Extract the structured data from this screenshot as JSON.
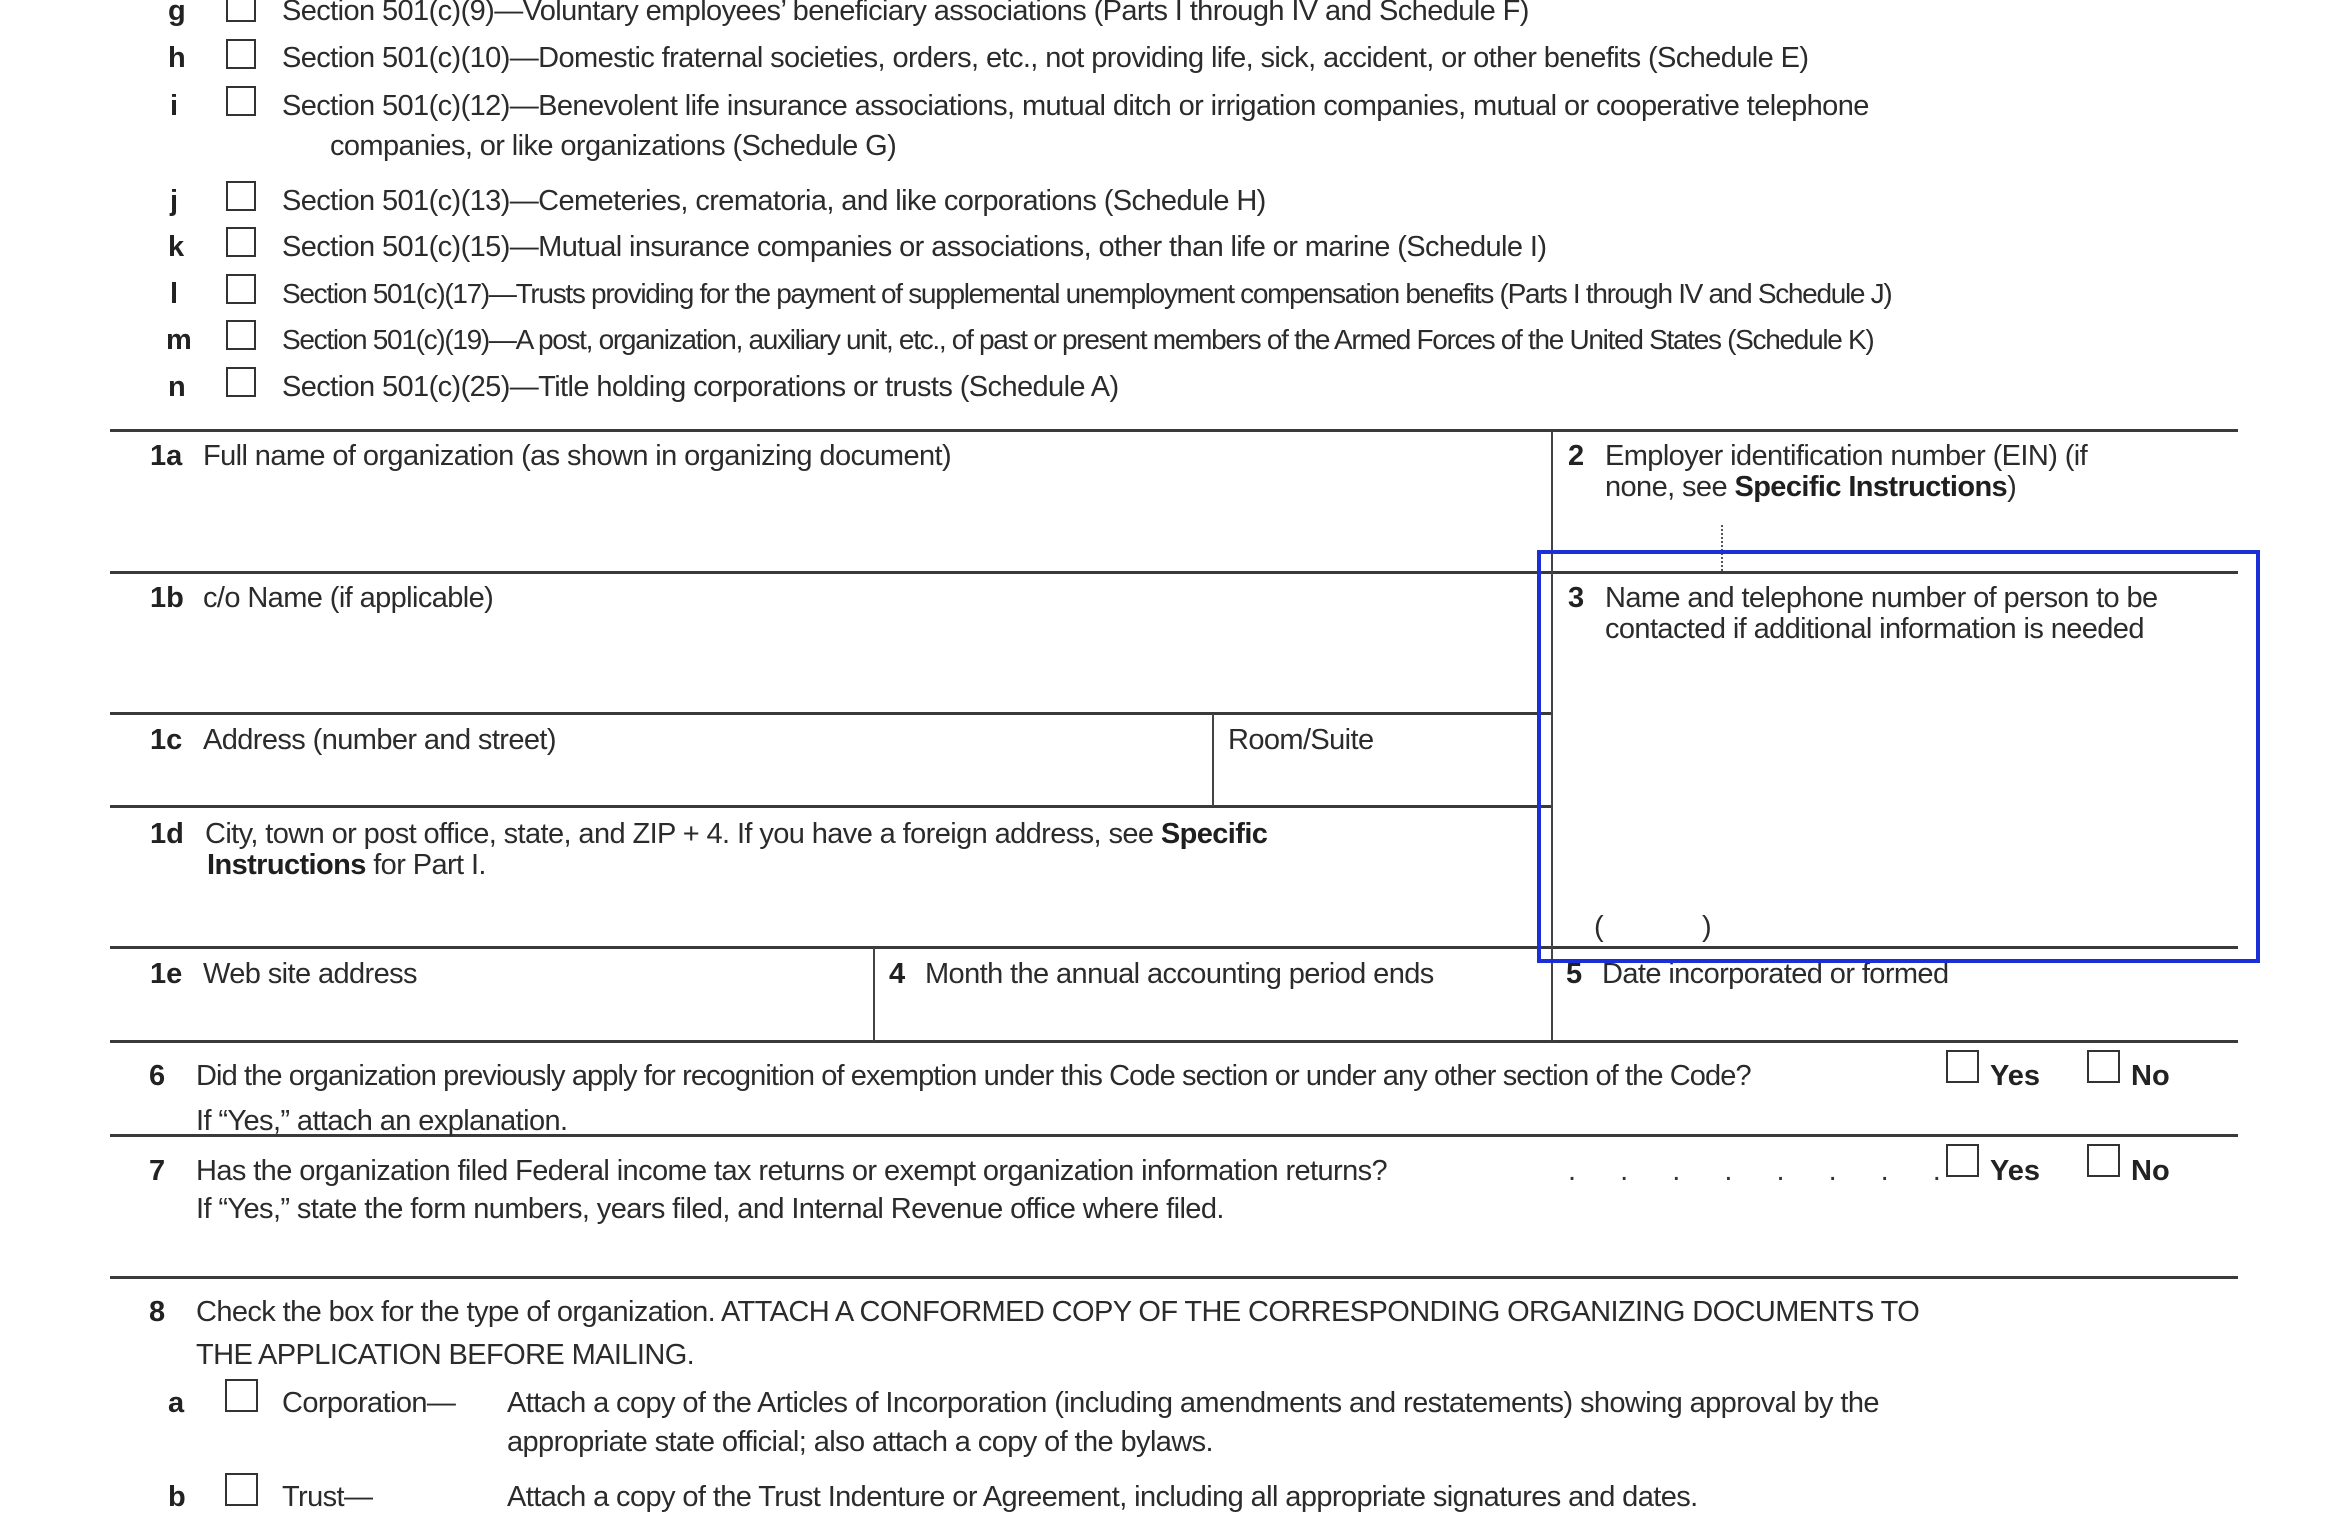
{
  "form_sections": {
    "items": [
      {
        "letter": "g",
        "text": "Section 501(c)(9)—Voluntary employees’ beneficiary associations (Parts I through IV and Schedule F)"
      },
      {
        "letter": "h",
        "text": "Section 501(c)(10)—Domestic fraternal societies, orders, etc., not providing life, sick, accident, or other benefits (Schedule E)"
      },
      {
        "letter": "i",
        "text": "Section 501(c)(12)—Benevolent life insurance associations, mutual ditch or irrigation companies, mutual or cooperative telephone",
        "text_cont": "companies, or like organizations (Schedule G)"
      },
      {
        "letter": "j",
        "text": "Section 501(c)(13)—Cemeteries, crematoria, and like corporations (Schedule H)"
      },
      {
        "letter": "k",
        "text": "Section 501(c)(15)—Mutual insurance companies or associations, other than life or marine (Schedule I)"
      },
      {
        "letter": "l",
        "text": "Section 501(c)(17)—Trusts providing for the payment of supplemental unemployment compensation benefits (Parts I through IV and  Schedule J)"
      },
      {
        "letter": "m",
        "text": "Section 501(c)(19)—A post, organization, auxiliary unit, etc., of past or present members of the Armed Forces of the United States (Schedule K)"
      },
      {
        "letter": "n",
        "text": "Section 501(c)(25)—Title holding corporations or trusts (Schedule A)"
      }
    ]
  },
  "fields": {
    "f1a": {
      "num": "1a",
      "label": "Full name of organization (as shown in organizing document)"
    },
    "f2": {
      "num": "2",
      "label_line1": "Employer identification number (EIN) (if",
      "label_line2_pre": "none, see ",
      "label_line2_bold": "Specific Instructions",
      "label_line2_post": ")"
    },
    "f1b": {
      "num": "1b",
      "label": "c/o Name (if applicable)"
    },
    "f3": {
      "num": "3",
      "label_line1": "Name and telephone number of person to be",
      "label_line2": "contacted if additional information is needed",
      "phone_open": "(",
      "phone_close": ")"
    },
    "f1c": {
      "num": "1c",
      "label": "Address (number and street)",
      "room_label": "Room/Suite"
    },
    "f1d": {
      "num": "1d",
      "label_line1_pre": "City, town or post office, state, and ZIP + 4. If you have a foreign address, see ",
      "label_line1_bold": "Specific",
      "label_line2_bold": "Instructions",
      "label_line2_post": " for Part I."
    },
    "f1e": {
      "num": "1e",
      "label": "Web site address"
    },
    "f4": {
      "num": "4",
      "label": "Month the annual accounting period ends"
    },
    "f5": {
      "num": "5",
      "label": "Date incorporated or formed"
    }
  },
  "questions": {
    "q6": {
      "num": "6",
      "text": "Did the organization previously apply for recognition of exemption under this Code section or under any other section of the Code?",
      "sub": "If “Yes,” attach an explanation.",
      "yes": "Yes",
      "no": "No"
    },
    "q7": {
      "num": "7",
      "text": "Has the organization filed Federal income tax returns or exempt organization information returns?",
      "dots": ". . . . . . . .",
      "sub": "If “Yes,” state the form numbers, years filed, and Internal Revenue office where filed.",
      "yes": "Yes",
      "no": "No"
    },
    "q8": {
      "num": "8",
      "text_line1": "Check the box for the type of organization. ATTACH A CONFORMED COPY OF THE CORRESPONDING ORGANIZING DOCUMENTS TO",
      "text_line2": "THE APPLICATION BEFORE MAILING.",
      "options": [
        {
          "letter": "a",
          "label": "Corporation—",
          "desc_line1": "Attach a copy of the Articles of Incorporation (including amendments and restatements) showing approval by the",
          "desc_line2": "appropriate state official; also attach a copy of the bylaws."
        },
        {
          "letter": "b",
          "label": "Trust—",
          "desc_line1": "Attach a copy of the Trust Indenture or Agreement, including all appropriate signatures and dates."
        }
      ]
    }
  },
  "highlight": {
    "target": "field 3",
    "color": "#1b2fd6"
  }
}
